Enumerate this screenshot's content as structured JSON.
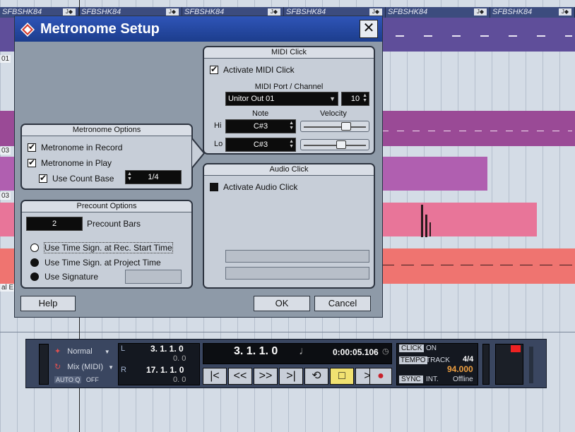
{
  "arrange": {
    "header_segments": [
      "SFBSHK84",
      "SFBSHK84",
      "SFBSHK84",
      "SFBSHK84",
      "SFBSHK84",
      "SFBSHK84"
    ],
    "track_labels": [
      "01",
      "03",
      "03",
      "al E"
    ],
    "colors": {
      "purple_dark": "#5f4e9a",
      "purple_mid": "#9a4a96",
      "pink": "#e87599",
      "salmon": "#ef7470",
      "header": "#3c4c7e"
    }
  },
  "dialog": {
    "title": "Metronome Setup",
    "close_glyph": "✕",
    "metronome_options": {
      "title": "Metronome Options",
      "record_label": "Metronome in Record",
      "record_checked": true,
      "play_label": "Metronome in Play",
      "play_checked": true,
      "count_base_label": "Use Count Base",
      "count_base_checked": true,
      "count_base_value": "1/4"
    },
    "precount_options": {
      "title": "Precount Options",
      "bars_value": "2",
      "bars_label": "Precount Bars",
      "radio_options": [
        "Use Time Sign. at Rec. Start Time",
        "Use Time Sign. at Project Time",
        "Use Signature"
      ],
      "selected_index": 0
    },
    "midi_click": {
      "title": "MIDI Click",
      "activate_label": "Activate MIDI Click",
      "activate_checked": true,
      "port_channel_label": "MIDI Port / Channel",
      "port_value": "Unitor Out 01",
      "channel_value": "10",
      "note_header": "Note",
      "velocity_header": "Velocity",
      "hi_label": "Hi",
      "hi_note": "C#3",
      "hi_velocity": 0.72,
      "lo_label": "Lo",
      "lo_note": "C#3",
      "lo_velocity": 0.62
    },
    "audio_click": {
      "title": "Audio Click",
      "activate_label": "Activate Audio Click",
      "activate_checked": false
    },
    "buttons": {
      "help": "Help",
      "ok": "OK",
      "cancel": "Cancel"
    }
  },
  "transport": {
    "mode_normal": "Normal",
    "mode_mix": "Mix (MIDI)",
    "auto_q_label": "AUTO Q",
    "auto_q_value": "OFF",
    "left_locator": "3. 1. 1. 0",
    "left_sub": "0. 0",
    "right_locator": "17. 1. 1. 0",
    "right_sub": "0. 0",
    "l_label": "L",
    "r_label": "R",
    "position_bars": "3. 1. 1. 0",
    "position_time": "0:00:05.106",
    "click_label": "CLICK",
    "click_value": "ON",
    "tempo_label": "TEMPO",
    "tempo_mode": "TRACK",
    "signature": "4/4",
    "tempo_value": "94.000",
    "sync_label": "SYNC",
    "sync_mode": "INT.",
    "sync_status": "Offline",
    "tempo_color": "#f0a040"
  }
}
